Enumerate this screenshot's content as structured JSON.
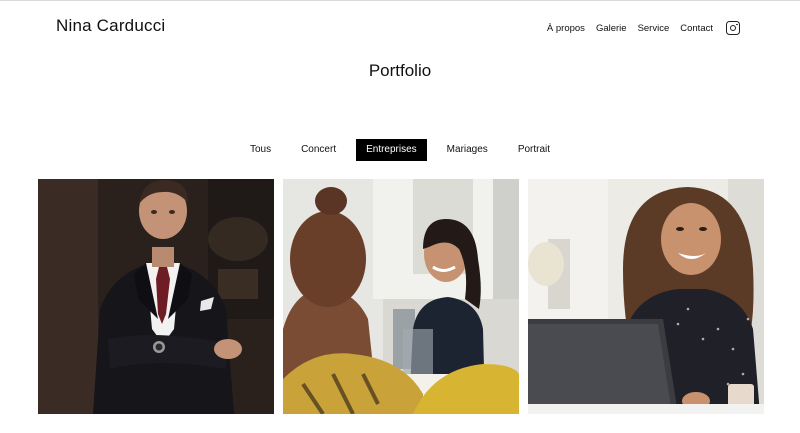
{
  "header": {
    "brand": "Nina Carducci",
    "nav": [
      "À propos",
      "Galerie",
      "Service",
      "Contact"
    ],
    "social_icon": "instagram-icon"
  },
  "page": {
    "title": "Portfolio"
  },
  "filters": {
    "items": [
      "Tous",
      "Concert",
      "Entreprises",
      "Mariages",
      "Portrait"
    ],
    "active": "Entreprises"
  },
  "gallery": {
    "items": [
      {
        "subject": "man in suit with crossed arms"
      },
      {
        "subject": "woman laughing in office behind colleague"
      },
      {
        "subject": "woman laughing at laptop"
      }
    ]
  },
  "colors": {
    "active_bg": "#000000",
    "active_text": "#ffffff"
  }
}
